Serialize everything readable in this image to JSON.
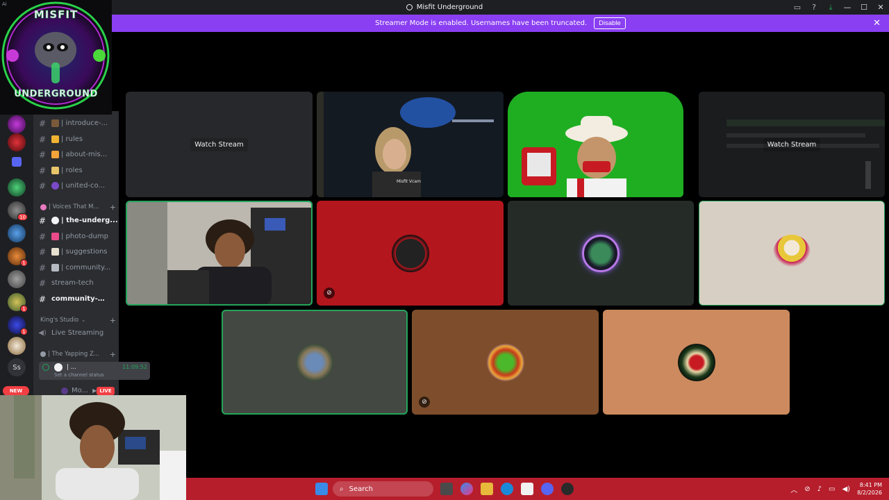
{
  "window": {
    "title": "Misfit Underground",
    "buttons": [
      "inbox-icon",
      "help-icon",
      "download-icon"
    ]
  },
  "banner": {
    "text": "Streamer Mode is enabled. Usernames have been truncated.",
    "disable_label": "Disable"
  },
  "logo": {
    "top_text": "MISFIT",
    "bottom_text": "UNDERGROUND",
    "corner_label": "Ai"
  },
  "guild_badges": [
    "10",
    "1",
    "1",
    "1"
  ],
  "guild_text": "Ss",
  "new_label": "NEW",
  "channels": [
    {
      "label": "| introduce-..."
    },
    {
      "label": "| rules"
    },
    {
      "label": "| about-mis..."
    },
    {
      "label": "| roles"
    },
    {
      "label": "| united-co..."
    }
  ],
  "categories": {
    "voices": "| Voices That M...",
    "kings": "King's Studio",
    "yapping": "| The Yapping Z..."
  },
  "channels2": [
    {
      "label": "| the-underg..."
    },
    {
      "label": "| photo-dump"
    },
    {
      "label": "| suggestions"
    },
    {
      "label": "| community..."
    },
    {
      "label": "stream-tech"
    },
    {
      "label": "community-em..."
    }
  ],
  "live_streaming": "Live Streaming",
  "voice_user": {
    "name": "| ...",
    "time": "11:09:52",
    "status": "Set a channel status"
  },
  "next_row": {
    "name": "Mo...",
    "live": "LIVE"
  },
  "tiles": {
    "watch_stream": "Watch Stream",
    "watch_stream_2": "Watch Stream",
    "tile_caption": "Misfit Vcam"
  },
  "taskbar": {
    "search": "Search",
    "time": "8:41 PM",
    "date": "8/2/2026"
  },
  "colors": {
    "banner": "#8a3ff2",
    "speaking": "#23a55a",
    "taskbar": "#b61e2c"
  }
}
